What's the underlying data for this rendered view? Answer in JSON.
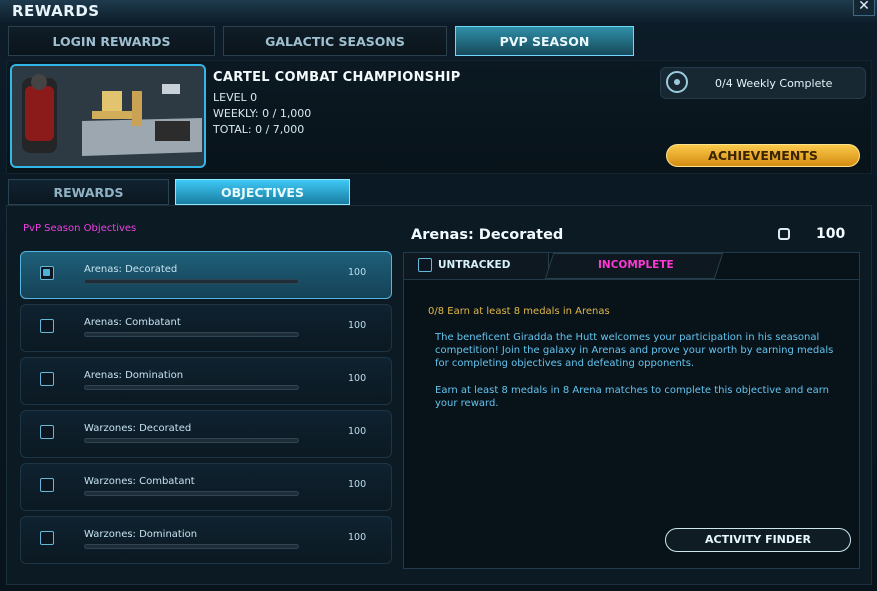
{
  "window": {
    "title": "REWARDS",
    "close_glyph": "✕"
  },
  "tabs": [
    "LOGIN REWARDS",
    "GALACTIC SEASONS",
    "PVP SEASON"
  ],
  "season": {
    "title": "CARTEL COMBAT CHAMPIONSHIP",
    "level": "LEVEL 0",
    "weekly": "WEEKLY: 0 / 1,000",
    "total": "TOTAL: 0 / 7,000",
    "weekly_complete": "0/4 Weekly Complete",
    "achievements_label": "ACHIEVEMENTS"
  },
  "subtabs": [
    "REWARDS",
    "OBJECTIVES"
  ],
  "objectives": {
    "section_label": "PvP Season Objectives",
    "items": [
      {
        "name": "Arenas: Decorated",
        "reward": "100",
        "progress": 0
      },
      {
        "name": "Arenas: Combatant",
        "reward": "100",
        "progress": 0
      },
      {
        "name": "Arenas: Domination",
        "reward": "100",
        "progress": 0
      },
      {
        "name": "Warzones: Decorated",
        "reward": "100",
        "progress": 0
      },
      {
        "name": "Warzones: Combatant",
        "reward": "100",
        "progress": 0
      },
      {
        "name": "Warzones: Domination",
        "reward": "100",
        "progress": 0
      }
    ]
  },
  "detail": {
    "title": "Arenas: Decorated",
    "reward": "100",
    "untracked": "UNTRACKED",
    "status": "INCOMPLETE",
    "requirement": "0/8 Earn at least 8 medals in Arenas",
    "description_1": "The beneficent Giradda the Hutt welcomes your participation in his seasonal competition! Join the galaxy in Arenas and prove your worth by earning medals for completing objectives and defeating opponents.",
    "description_2": "Earn at least 8 medals in 8 Arena matches to complete this objective and earn your reward.",
    "activity_finder": "ACTIVITY FINDER"
  },
  "colors": {
    "accent": "#3ec8f5",
    "gold": "#fbc94a",
    "magenta": "#ff37d4",
    "desc_text": "#63c4ef"
  },
  "icons": {
    "weekly": "target-icon",
    "reward": "trophy-icon"
  }
}
